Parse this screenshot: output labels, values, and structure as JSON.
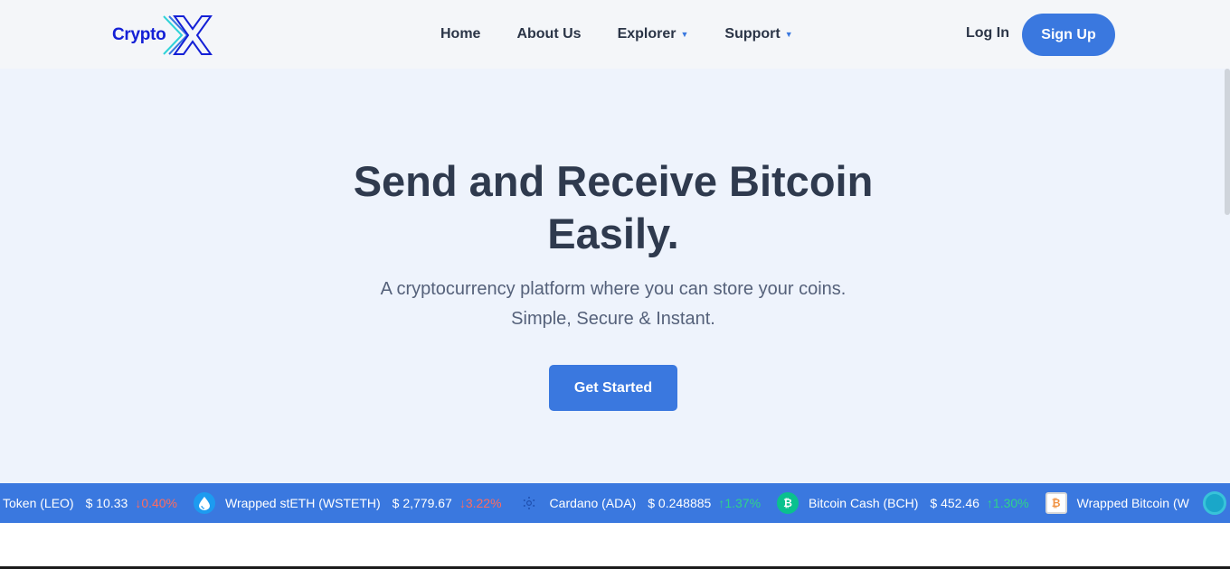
{
  "header": {
    "logo_text": "Crypto",
    "nav": [
      {
        "label": "Home",
        "has_caret": false
      },
      {
        "label": "About Us",
        "has_caret": false
      },
      {
        "label": "Explorer",
        "has_caret": true
      },
      {
        "label": "Support",
        "has_caret": true
      }
    ],
    "login_label": "Log In",
    "signup_label": "Sign Up"
  },
  "hero": {
    "title_line1": "Send and Receive Bitcoin",
    "title_line2": "Easily.",
    "subtitle_line1": "A cryptocurrency platform where you can store your coins.",
    "subtitle_line2": "Simple, Secure & Instant.",
    "cta_label": "Get Started"
  },
  "ticker": {
    "items": [
      {
        "name": "Token (LEO)",
        "price": "$ 10.33",
        "change": "0.40%",
        "direction": "down",
        "icon": "none"
      },
      {
        "name": "Wrapped stETH (WSTETH)",
        "price": "$ 2,779.67",
        "change": "3.22%",
        "direction": "down",
        "icon": "drop-icon"
      },
      {
        "name": "Cardano (ADA)",
        "price": "$ 0.248885",
        "change": "1.37%",
        "direction": "up",
        "icon": "cardano-icon"
      },
      {
        "name": "Bitcoin Cash (BCH)",
        "price": "$ 452.46",
        "change": "1.30%",
        "direction": "up",
        "icon": "bitcoin-cash-icon"
      },
      {
        "name": "Wrapped Bitcoin (W",
        "price": "",
        "change": "",
        "direction": "",
        "icon": "wrapped-bitcoin-icon"
      }
    ]
  },
  "colors": {
    "accent": "#3a78df",
    "hero_bg": "#eef3fc",
    "header_bg": "#f4f6f9",
    "down": "#ff6b5e",
    "up": "#2fd38a",
    "logo": "#1420d6"
  }
}
